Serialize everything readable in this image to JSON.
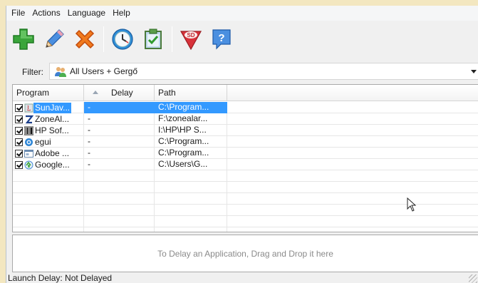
{
  "menu": [
    "File",
    "Actions",
    "Language",
    "Help"
  ],
  "toolbar": {
    "buttons": [
      {
        "name": "add-icon",
        "color": "#3aa53a"
      },
      {
        "name": "edit-pencil-icon",
        "color": "#3b7fd6"
      },
      {
        "name": "remove-x-icon",
        "color": "#f07a1e"
      },
      {
        "name": "clock-icon",
        "color": "#2f8fd8"
      },
      {
        "name": "clipboard-check-icon",
        "color": "#4a9d3b"
      },
      {
        "name": "sd-logo-icon",
        "color": "#d8323a"
      },
      {
        "name": "help-icon",
        "color": "#3b7fd6"
      }
    ]
  },
  "filter": {
    "label": "Filter:",
    "value": "All Users + Gergő"
  },
  "table": {
    "columns": [
      "Program",
      "Delay",
      "Path"
    ],
    "rows": [
      {
        "program": "SunJav...",
        "delay": "-",
        "path": "C:\\Program...",
        "icon": "java-icon",
        "selected": true
      },
      {
        "program": "ZoneAl...",
        "delay": "-",
        "path": "F:\\zonealar...",
        "icon": "zonealarm-icon",
        "selected": false
      },
      {
        "program": "HP Sof...",
        "delay": "-",
        "path": "I:\\HP\\HP S...",
        "icon": "barcode-icon",
        "selected": false
      },
      {
        "program": "egui",
        "delay": "-",
        "path": "C:\\Program...",
        "icon": "eset-icon",
        "selected": false
      },
      {
        "program": "Adobe ...",
        "delay": "-",
        "path": "C:\\Program...",
        "icon": "adobe-window-icon",
        "selected": false
      },
      {
        "program": "Google...",
        "delay": "-",
        "path": "C:\\Users\\G...",
        "icon": "google-update-icon",
        "selected": false
      }
    ]
  },
  "dropzone": {
    "text": "To Delay an Application, Drag and Drop it here"
  },
  "status": {
    "text": "Launch Delay: Not Delayed"
  },
  "colors": {
    "selection": "#3399ff",
    "background_outside": "#f3e7c0"
  }
}
